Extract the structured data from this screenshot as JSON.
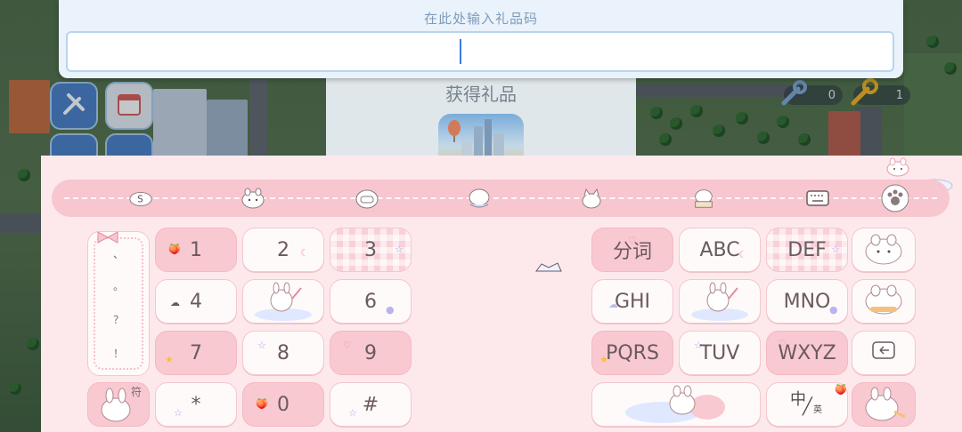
{
  "input_panel": {
    "prompt": "在此处输入礼品码",
    "value": ""
  },
  "gift_dialog": {
    "title": "获得礼品"
  },
  "counters": {
    "left_value": "0",
    "right_value": "1"
  },
  "toolbar": {
    "icons": [
      "emoji-s-icon",
      "bunny-face-icon",
      "robot-face-icon",
      "bunny-float-icon",
      "cat-icon",
      "bunny-book-icon",
      "keyboard-icon",
      "paw-icon"
    ]
  },
  "keyboard_left": {
    "punctuation": [
      "、",
      "。",
      "？",
      "！"
    ],
    "keys": [
      {
        "label": "1",
        "name": "key-1"
      },
      {
        "label": "2",
        "name": "key-2"
      },
      {
        "label": "3",
        "name": "key-3"
      },
      {
        "label": "4",
        "name": "key-4"
      },
      {
        "label": "6",
        "name": "key-6"
      },
      {
        "label": "7",
        "name": "key-7"
      },
      {
        "label": "8",
        "name": "key-8"
      },
      {
        "label": "9",
        "name": "key-9"
      },
      {
        "label": "*",
        "name": "key-star"
      },
      {
        "label": "0",
        "name": "key-0"
      },
      {
        "label": "#",
        "name": "key-hash"
      }
    ],
    "symbol_label": "符"
  },
  "keyboard_right": {
    "keys": [
      {
        "label": "分词",
        "name": "key-segment"
      },
      {
        "label": "ABC",
        "name": "key-abc"
      },
      {
        "label": "DEF",
        "name": "key-def"
      },
      {
        "label": "GHI",
        "name": "key-ghi"
      },
      {
        "label": "MNO",
        "name": "key-mno"
      },
      {
        "label": "PQRS",
        "name": "key-pqrs"
      },
      {
        "label": "TUV",
        "name": "key-tuv"
      },
      {
        "label": "WXYZ",
        "name": "key-wxyz"
      }
    ],
    "lang_cn": "中",
    "lang_en": "英"
  },
  "colors": {
    "keyboard_bg": "#fde9ec",
    "key_pink": "#f9c9d1",
    "key_white": "#fffafa",
    "accent_caret": "#3d7be0",
    "toolbar": "#f7c6cf"
  }
}
